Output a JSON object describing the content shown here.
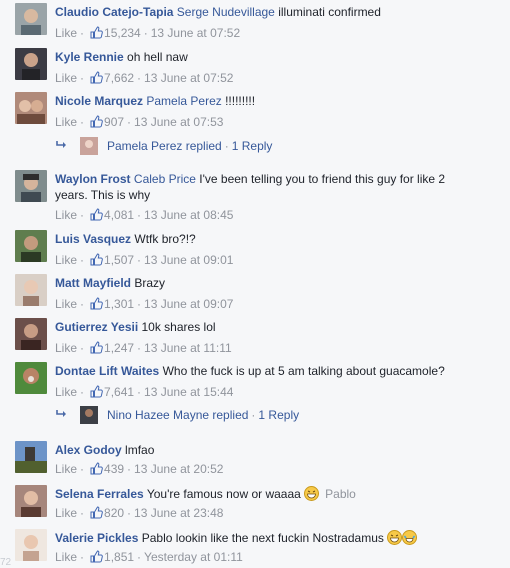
{
  "meta_like_label": "Like",
  "meta_dot": "·",
  "comments": [
    {
      "author": "Claudio Catejo-Tapia",
      "tag": "Serge Nudevillage",
      "text": "illuminati confirmed",
      "likes": "15,234",
      "time": "13 June at 07:52"
    },
    {
      "author": "Kyle Rennie",
      "tag": "",
      "text": "oh hell naw",
      "likes": "7,662",
      "time": "13 June at 07:52"
    },
    {
      "author": "Nicole Marquez",
      "tag": "Pamela Perez",
      "text": "!!!!!!!!!",
      "likes": "907",
      "time": "13 June at 07:53"
    },
    {
      "author": "Waylon Frost",
      "tag": "Caleb Price",
      "text": "I've been telling you to friend this guy for like 2 years. This is why",
      "likes": "4,081",
      "time": "13 June at 08:45"
    },
    {
      "author": "Luis Vasquez",
      "tag": "",
      "text": "Wtfk bro?!?",
      "likes": "1,507",
      "time": "13 June at 09:01"
    },
    {
      "author": "Matt Mayfield",
      "tag": "",
      "text": "Brazy",
      "likes": "1,301",
      "time": "13 June at 09:07"
    },
    {
      "author": "Gutierrez Yesii",
      "tag": "",
      "text": "10k shares lol",
      "likes": "1,247",
      "time": "13 June at 11:11"
    },
    {
      "author": "Dontae Lift Waites",
      "tag": "",
      "text": "Who the fuck is up at 5 am talking about guacamole?",
      "likes": "7,641",
      "time": "13 June at 15:44"
    },
    {
      "author": "Alex Godoy",
      "tag": "",
      "text": "lmfao",
      "likes": "439",
      "time": "13 June at 20:52"
    },
    {
      "author": "Selena Ferrales",
      "tag": "",
      "text": "You're famous now or waaaa",
      "tag_after": "Pablo",
      "likes": "820",
      "time": "13 June at 23:48"
    },
    {
      "author": "Valerie Pickles",
      "tag": "",
      "text": "Pablo lookin like the next fuckin Nostradamus",
      "likes": "1,851",
      "time": "Yesterday at 01:11"
    }
  ],
  "replies": [
    {
      "name": "Pamela Perez replied",
      "count": "1 Reply"
    },
    {
      "name": "Nino Hazee Mayne replied",
      "count": "1 Reply"
    }
  ],
  "watermark": "72",
  "colors": {
    "link": "#365899",
    "meta": "#90949c",
    "bg": "#f6f7f9"
  }
}
